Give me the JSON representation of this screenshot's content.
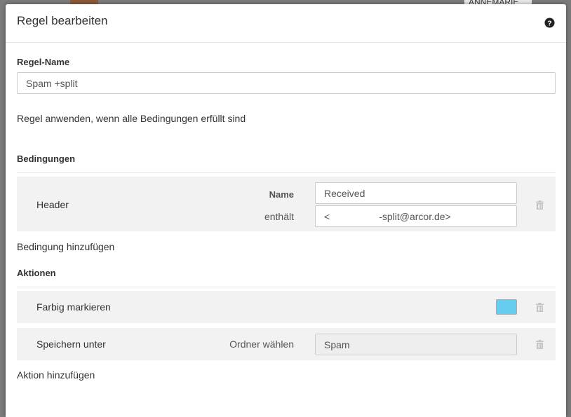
{
  "dialog": {
    "title": "Regel bearbeiten"
  },
  "rule_name": {
    "label": "Regel-Name",
    "value": "Spam +split"
  },
  "apply_text": "Regel anwenden, wenn alle Bedingungen erfüllt sind",
  "conditions": {
    "heading": "Bedingungen",
    "items": [
      {
        "type_label": "Header",
        "name_label": "Name",
        "name_value": "Received",
        "operator_label": "enthält",
        "contains_value": "<                  -split@arcor.de>"
      }
    ],
    "add_label": "Bedingung hinzufügen"
  },
  "actions": {
    "heading": "Aktionen",
    "items": [
      {
        "title": "Farbig markieren",
        "color": "#66ccf0"
      },
      {
        "title": "Speichern unter",
        "folder_label": "Ordner wählen",
        "folder_value": "Spam"
      }
    ],
    "add_label": "Aktion hinzufügen"
  },
  "backdrop": {
    "name_fragment": "ANNEMARIE"
  },
  "icons": {
    "help": "help-icon",
    "trash": "trash-icon"
  },
  "colors": {
    "row_bg": "#f2f2f2",
    "divider": "#e5e5e5"
  }
}
